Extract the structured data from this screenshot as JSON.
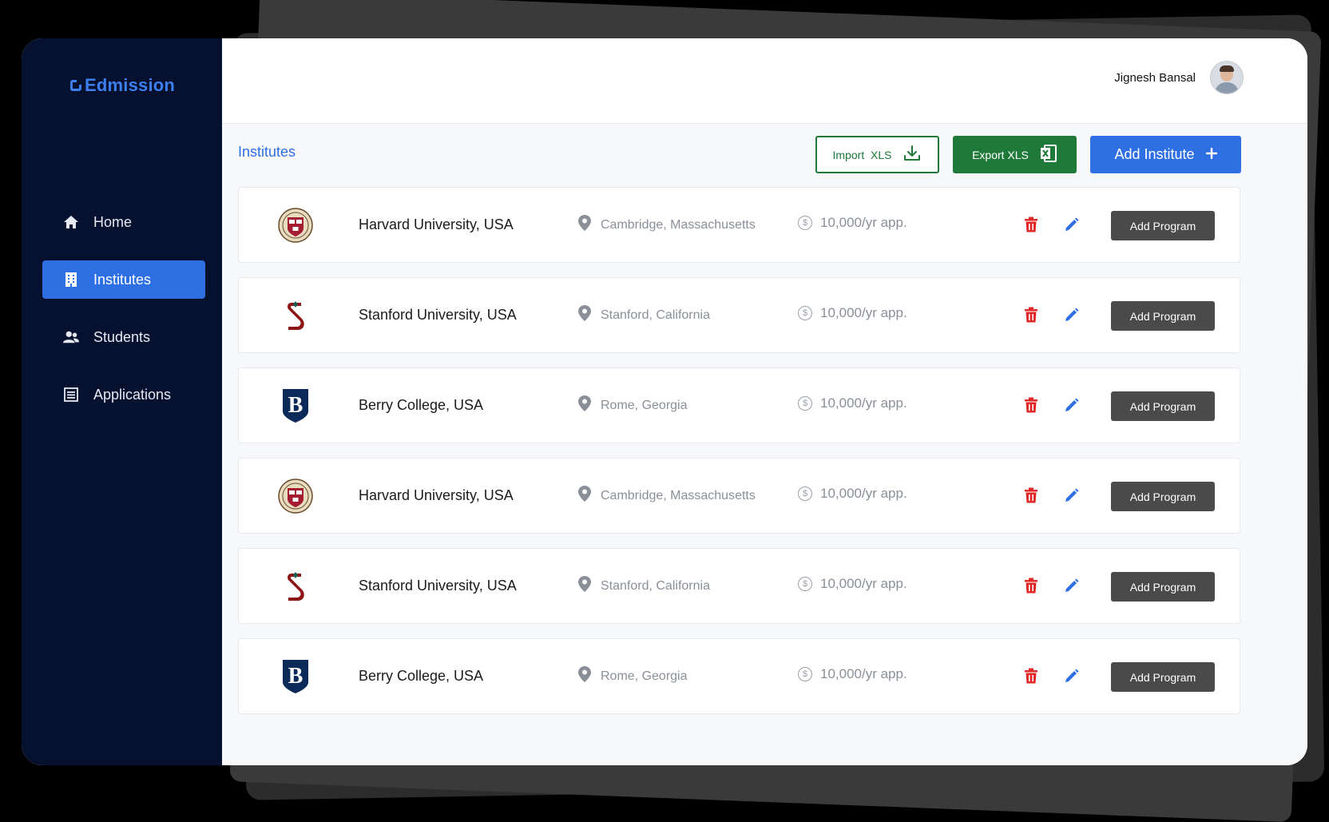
{
  "app": {
    "name": "Edmission"
  },
  "sidebar": {
    "items": [
      {
        "label": "Home",
        "icon": "home-icon",
        "active": false
      },
      {
        "label": "Institutes",
        "icon": "building-icon",
        "active": true
      },
      {
        "label": "Students",
        "icon": "users-icon",
        "active": false
      },
      {
        "label": "Applications",
        "icon": "list-icon",
        "active": false
      }
    ]
  },
  "header": {
    "user_name": "Jignesh Bansal"
  },
  "page": {
    "title": "Institutes"
  },
  "toolbar": {
    "import_label": "Import  XLS",
    "export_label": "Export XLS",
    "add_label": "Add Institute"
  },
  "institutes": [
    {
      "name": "Harvard University, USA",
      "location": "Cambridge, Massachusetts",
      "fee": "10,000/yr app.",
      "logo": "harvard-logo",
      "action": "Add Program"
    },
    {
      "name": "Stanford University, USA",
      "location": "Stanford, California",
      "fee": "10,000/yr app.",
      "logo": "stanford-logo",
      "action": "Add Program"
    },
    {
      "name": "Berry College, USA",
      "location": "Rome, Georgia",
      "fee": "10,000/yr app.",
      "logo": "berry-logo",
      "action": "Add Program"
    },
    {
      "name": "Harvard University, USA",
      "location": "Cambridge, Massachusetts",
      "fee": "10,000/yr app.",
      "logo": "harvard-logo",
      "action": "Add Program"
    },
    {
      "name": "Stanford University, USA",
      "location": "Stanford, California",
      "fee": "10,000/yr app.",
      "logo": "stanford-logo",
      "action": "Add Program"
    },
    {
      "name": "Berry College, USA",
      "location": "Rome, Georgia",
      "fee": "10,000/yr app.",
      "logo": "berry-logo",
      "action": "Add Program"
    }
  ],
  "colors": {
    "sidebar_bg": "#06102f",
    "accent_blue": "#2f6fe4",
    "green": "#1f7a3a",
    "delete_red": "#e02828",
    "dark_button": "#4a4a4a"
  }
}
